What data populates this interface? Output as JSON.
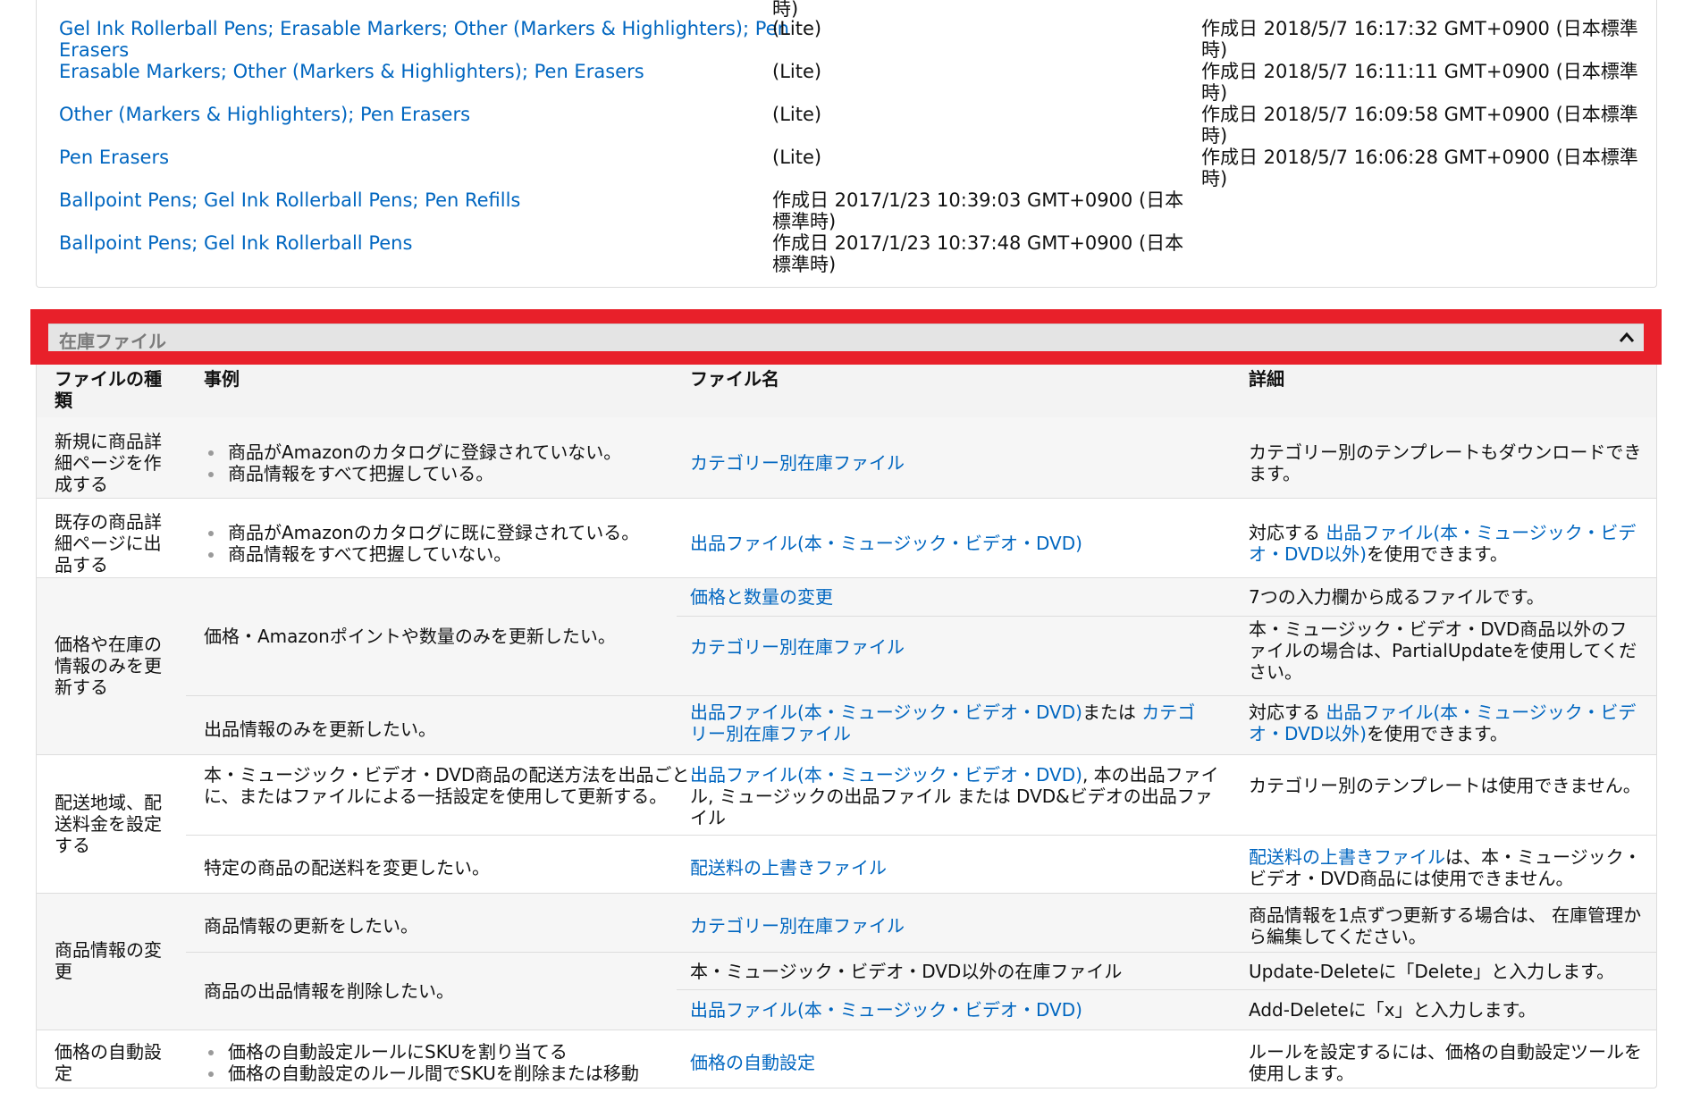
{
  "top_list": {
    "overflow_top": "時)",
    "rows": [
      {
        "name": "Gel Ink Rollerball Pens; Erasable Markers; Other (Markers & Highlighters); Pen Erasers",
        "type": "(Lite)",
        "date": "作成日 2018/5/7 16:17:32 GMT+0900 (日本標準時)"
      },
      {
        "name": "Erasable Markers; Other (Markers & Highlighters); Pen Erasers",
        "type": "(Lite)",
        "date": "作成日 2018/5/7 16:11:11 GMT+0900 (日本標準時)"
      },
      {
        "name": "Other (Markers & Highlighters); Pen Erasers",
        "type": "(Lite)",
        "date": "作成日 2018/5/7 16:09:58 GMT+0900 (日本標準時)"
      },
      {
        "name": "Pen Erasers",
        "type": "(Lite)",
        "date": "作成日 2018/5/7 16:06:28 GMT+0900 (日本標準時)"
      },
      {
        "name": "Ballpoint Pens; Gel Ink Rollerball Pens; Pen Refills",
        "date": "作成日 2017/1/23 10:39:03 GMT+0900 (日本標準時)"
      },
      {
        "name": "Ballpoint Pens; Gel Ink Rollerball Pens",
        "date": "作成日 2017/1/23 10:37:48 GMT+0900 (日本標準時)"
      }
    ]
  },
  "section": {
    "title": "在庫ファイル",
    "collapse_icon": "chevron-up-icon",
    "highlight_color": "#e8202a"
  },
  "inventory": {
    "headers": {
      "type": "ファイルの種類",
      "case": "事例",
      "file": "ファイル名",
      "detail": "詳細"
    },
    "r1": {
      "type": "新規に商品詳細ページを作成する",
      "case": [
        "商品がAmazonのカタログに登録されていない。",
        "商品情報をすべて把握している。"
      ],
      "file": "カテゴリー別在庫ファイル",
      "detail": "カテゴリー別のテンプレートもダウンロードできます。"
    },
    "r2": {
      "type": "既存の商品詳細ページに出品する",
      "case": [
        "商品がAmazonのカタログに既に登録されている。",
        "商品情報をすべて把握していない。"
      ],
      "file": "出品ファイル(本・ミュージック・ビデオ・DVD)",
      "detail_pre": "対応する ",
      "detail_link": "出品ファイル(本・ミュージック・ビデオ・DVD以外)",
      "detail_post": "を使用できます。"
    },
    "r3": {
      "type": "価格や在庫の情報のみを更新する",
      "case_a": "価格・Amazonポイントや数量のみを更新したい。",
      "file_a1": "価格と数量の変更",
      "detail_a1": "7つの入力欄から成るファイルです。",
      "file_a2": "カテゴリー別在庫ファイル",
      "detail_a2": "本・ミュージック・ビデオ・DVD商品以外のファイルの場合は、PartialUpdateを使用してください。",
      "case_b": "出品情報のみを更新したい。",
      "file_b_link1": "出品ファイル(本・ミュージック・ビデオ・DVD)",
      "file_b_mid": "または ",
      "file_b_link2": "カテゴリー別在庫ファイル",
      "detail_b_pre": "対応する ",
      "detail_b_link": "出品ファイル(本・ミュージック・ビデオ・DVD以外)",
      "detail_b_post": "を使用できます。"
    },
    "r4": {
      "type": "配送地域、配送料金を設定する",
      "case_a": "本・ミュージック・ビデオ・DVD商品の配送方法を出品ごとに、またはファイルによる一括設定を使用して更新する。",
      "file_a_link": "出品ファイル(本・ミュージック・ビデオ・DVD)",
      "file_a_text": ", 本の出品ファイル, ミュージックの出品ファイル または DVD&ビデオの出品ファイル",
      "detail_a": "カテゴリー別のテンプレートは使用できません。",
      "case_b": "特定の商品の配送料を変更したい。",
      "file_b": "配送料の上書きファイル",
      "detail_b_link": "配送料の上書きファイル",
      "detail_b_text": "は、本・ミュージック・ビデオ・DVD商品には使用できません。"
    },
    "r5": {
      "type": "商品情報の変更",
      "case_a": "商品情報の更新をしたい。",
      "file_a": "カテゴリー別在庫ファイル",
      "detail_a": "商品情報を1点ずつ更新する場合は、 在庫管理から編集してください。",
      "case_b": "商品の出品情報を削除したい。",
      "file_b1": "本・ミュージック・ビデオ・DVD以外の在庫ファイル",
      "detail_b1": "Update-Deleteに「Delete」と入力します。",
      "file_b2": "出品ファイル(本・ミュージック・ビデオ・DVD)",
      "detail_b2": "Add-Deleteに「x」と入力します。"
    },
    "r6": {
      "type": "価格の自動設定",
      "case": [
        "価格の自動設定ルールにSKUを割り当てる",
        "価格の自動設定のルール間でSKUを削除または移動"
      ],
      "file": "価格の自動設定",
      "detail": "ルールを設定するには、価格の自動設定ツールを使用します。"
    }
  }
}
